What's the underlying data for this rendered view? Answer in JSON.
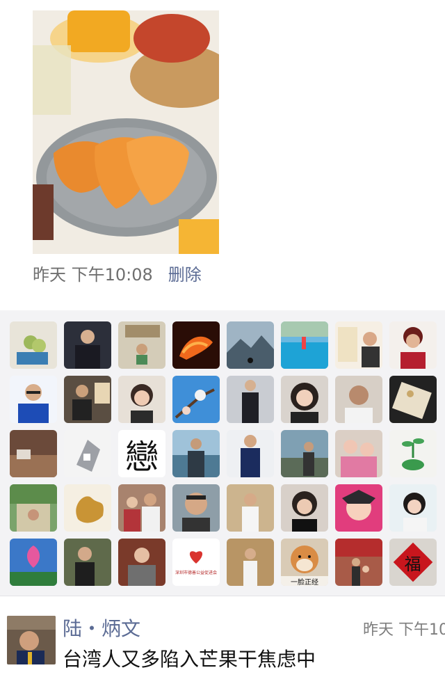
{
  "post": {
    "image_alt": "dried mango slices on a gray plate with fresh mangoes and a basket",
    "time": "昨天 下午10:08",
    "delete_label": "删除"
  },
  "likes": {
    "avatar_icons": [
      "grapes-painting-icon",
      "man-in-suit-avatar",
      "office-photo-avatar",
      "fire-horse-avatar",
      "mountain-silhouette-avatar",
      "pool-photo-avatar",
      "woman-with-box-avatar",
      "woman-red-portrait-avatar",
      "man-glasses-avatar",
      "man-seated-avatar",
      "woman-portrait-avatar",
      "flower-branch-avatar",
      "man-standing-avatar",
      "woman-closeup-avatar",
      "man-portrait-avatar",
      "tea-cup-avatar",
      "tea-table-avatar",
      "stone-lantern-avatar",
      "calligraphy-avatar",
      "man-beach-avatar",
      "man-pose-avatar",
      "man-street-avatar",
      "girls-photo-avatar",
      "plant-hand-avatar",
      "garden-people-avatar",
      "phoenix-art-avatar",
      "two-people-avatar",
      "man-smiling-avatar",
      "man-hat-avatar",
      "man-walking-avatar",
      "woman-close-avatar",
      "opera-face-avatar",
      "lotus-flower-avatar",
      "woman-phone-avatar",
      "woman-coat-avatar",
      "charity-logo-avatar",
      "man-stage-avatar",
      "shiba-dog-avatar",
      "family-street-avatar",
      "fu-character-avatar"
    ],
    "dog_caption": "一脸正经",
    "logo_text": "深圳市德善公益促进会",
    "fu_text": "福",
    "calligraphy_text": "戀"
  },
  "next_post": {
    "author": "陆・炳文",
    "time": "昨天 下午10",
    "text": "台湾人又多陷入芒果干焦虑中"
  }
}
